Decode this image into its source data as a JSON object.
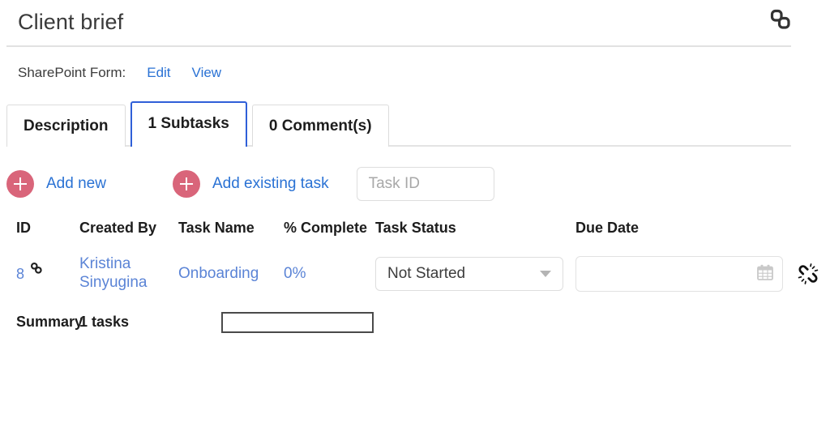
{
  "header": {
    "title": "Client brief",
    "link_icon": "chain-link-icon"
  },
  "sharepoint": {
    "label": "SharePoint Form:",
    "edit_label": "Edit",
    "view_label": "View"
  },
  "tabs": [
    {
      "label": "Description",
      "active": false
    },
    {
      "label": "1 Subtasks",
      "active": true
    },
    {
      "label": "0 Comment(s)",
      "active": false
    }
  ],
  "toolbar": {
    "add_new_label": "Add new",
    "add_existing_label": "Add existing task",
    "task_id_value": "",
    "task_id_placeholder": "Task ID",
    "plus_icon": "plus-icon",
    "accent_color": "#d9657a"
  },
  "table": {
    "headers": {
      "id": "ID",
      "created_by": "Created By",
      "task_name": "Task Name",
      "percent_complete": "% Complete",
      "task_status": "Task Status",
      "due_date": "Due Date"
    },
    "rows": [
      {
        "id": "8",
        "id_link_icon": "chain-link-icon",
        "created_by": "Kristina Sinyugina",
        "task_name": "Onboarding",
        "percent_complete": "0%",
        "task_status": "Not Started",
        "due_date": "",
        "due_date_icon": "calendar-icon",
        "action_icon": "unlink-icon"
      }
    ]
  },
  "summary": {
    "label": "Summary",
    "count": "1 tasks",
    "box_value": ""
  },
  "colors": {
    "link": "#2a72d4",
    "row_link": "#5b84d6",
    "active_tab_border": "#2f5fd8",
    "accent": "#d9657a"
  }
}
